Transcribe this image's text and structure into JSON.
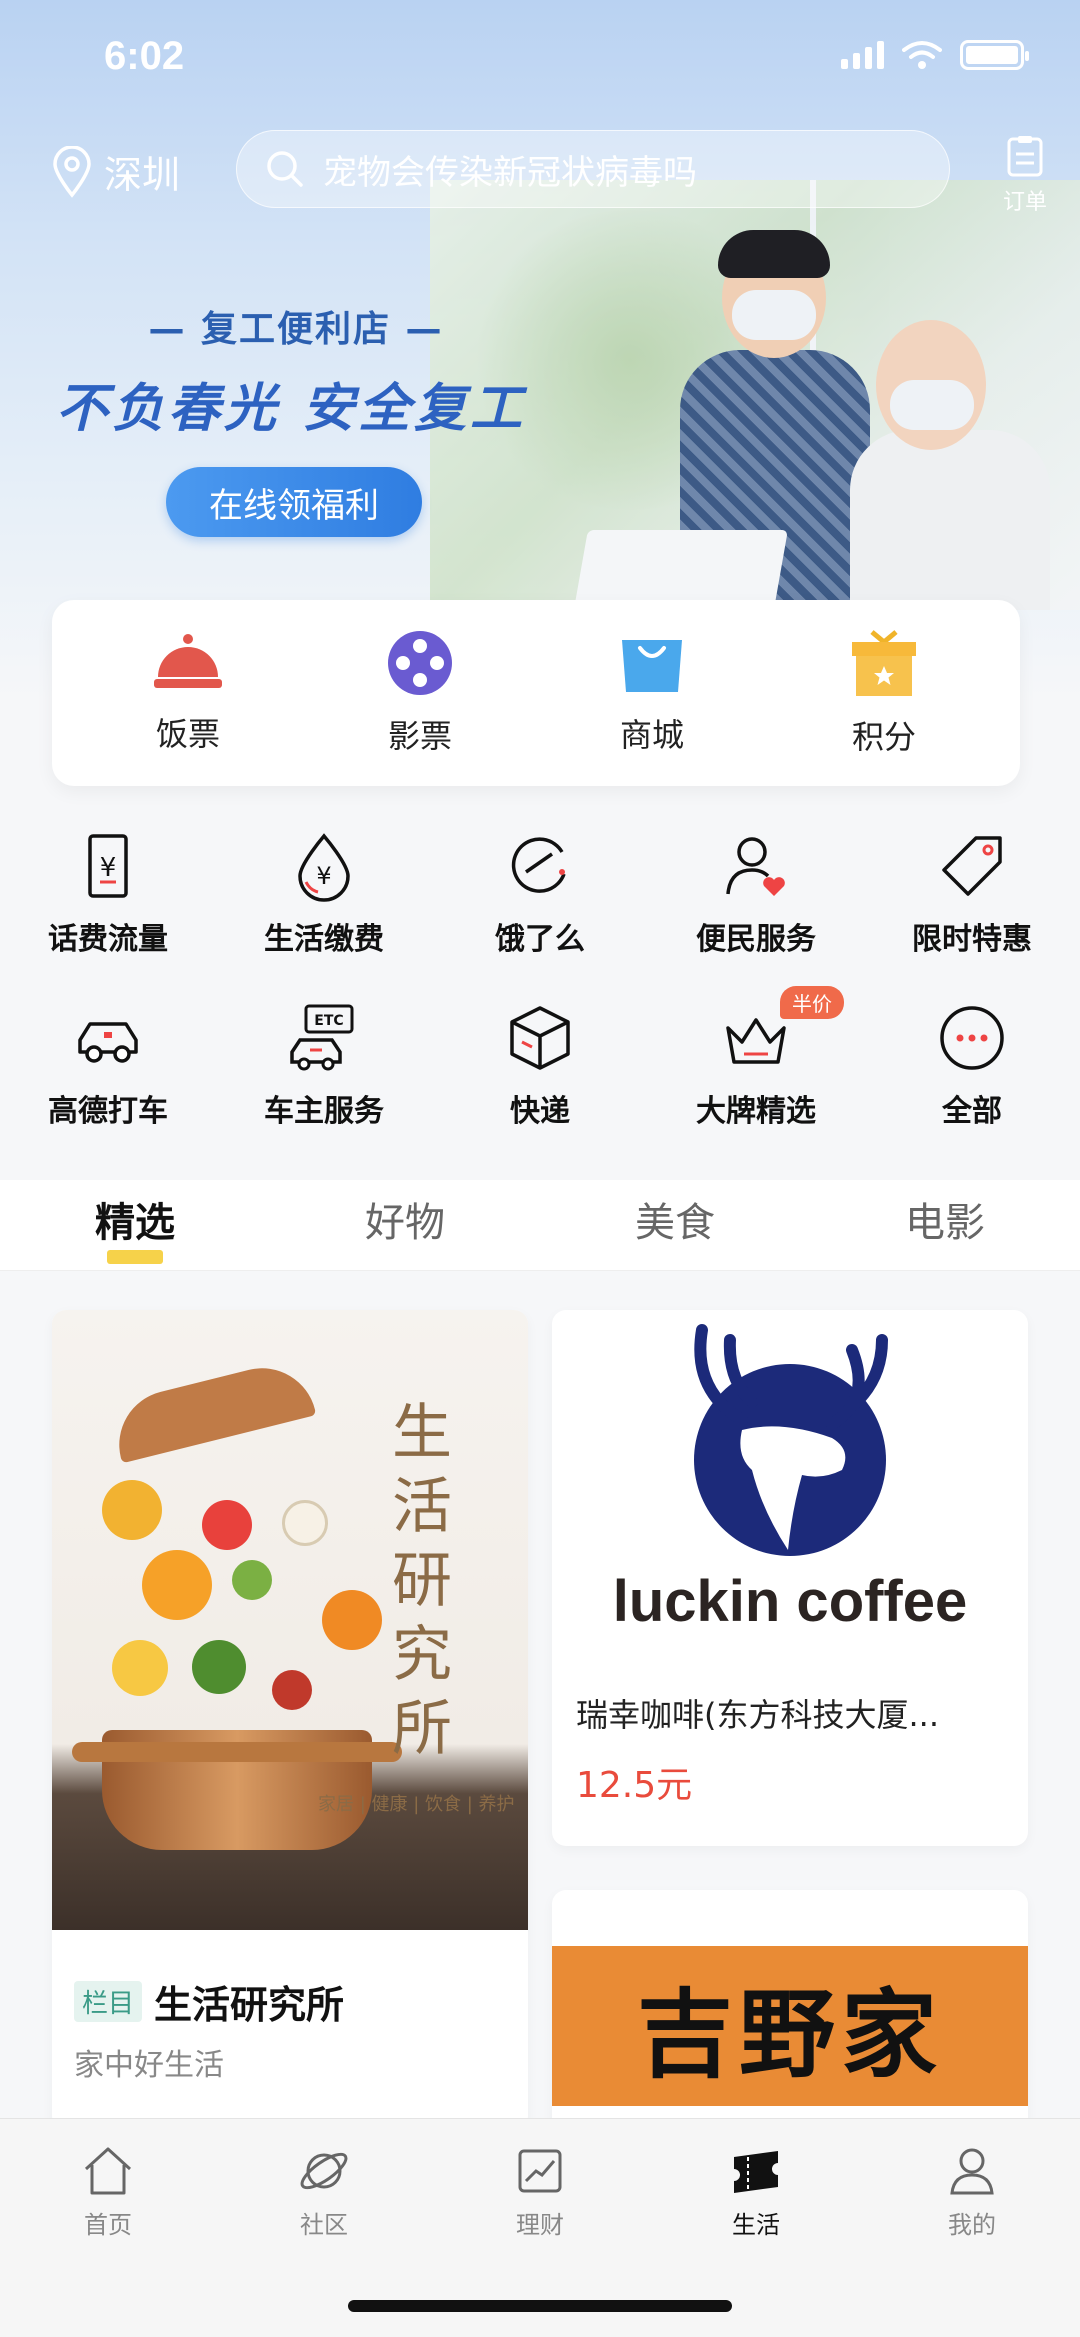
{
  "status": {
    "time": "6:02"
  },
  "header": {
    "city": "深圳",
    "search_placeholder": "宠物会传染新冠状病毒吗",
    "order_label": "订单"
  },
  "banner": {
    "subtitle": "— 复工便利店 —",
    "title": "不负春光 安全复工",
    "cta": "在线领福利"
  },
  "quick": [
    {
      "label": "饭票",
      "icon": "cloche-icon"
    },
    {
      "label": "影票",
      "icon": "film-reel-icon"
    },
    {
      "label": "商城",
      "icon": "shopping-bag-icon"
    },
    {
      "label": "积分",
      "icon": "gift-box-icon"
    }
  ],
  "services": [
    {
      "label": "话费流量",
      "icon": "phone-bill-icon"
    },
    {
      "label": "生活缴费",
      "icon": "utility-payment-icon"
    },
    {
      "label": "饿了么",
      "icon": "eleme-icon"
    },
    {
      "label": "便民服务",
      "icon": "community-service-icon"
    },
    {
      "label": "限时特惠",
      "icon": "price-tag-icon"
    },
    {
      "label": "高德打车",
      "icon": "taxi-icon"
    },
    {
      "label": "车主服务",
      "icon": "etc-car-icon"
    },
    {
      "label": "快递",
      "icon": "package-icon"
    },
    {
      "label": "大牌精选",
      "icon": "crown-icon",
      "badge": "半价"
    },
    {
      "label": "全部",
      "icon": "more-icon"
    }
  ],
  "tabs": [
    "精选",
    "好物",
    "美食",
    "电影"
  ],
  "feed": {
    "left": {
      "vertical_text": "生活研究所",
      "tag_line": "家居 | 健康 | 饮食 | 养护",
      "badge": "栏目",
      "title": "生活研究所",
      "subtitle": "家中好生活"
    },
    "right1": {
      "brand": "luckin coffee",
      "name": "瑞幸咖啡(东方科技大厦...",
      "price": "12.5元"
    },
    "right2": {
      "brand": "吉野家"
    }
  },
  "nav": [
    {
      "label": "首页",
      "icon": "home-icon"
    },
    {
      "label": "社区",
      "icon": "planet-icon"
    },
    {
      "label": "理财",
      "icon": "chart-icon"
    },
    {
      "label": "生活",
      "icon": "ticket-icon",
      "active": true
    },
    {
      "label": "我的",
      "icon": "profile-icon"
    }
  ],
  "colors": {
    "accent": "#2f7de1",
    "price": "#e94b3c",
    "tab_indicator": "#f6d24a"
  }
}
